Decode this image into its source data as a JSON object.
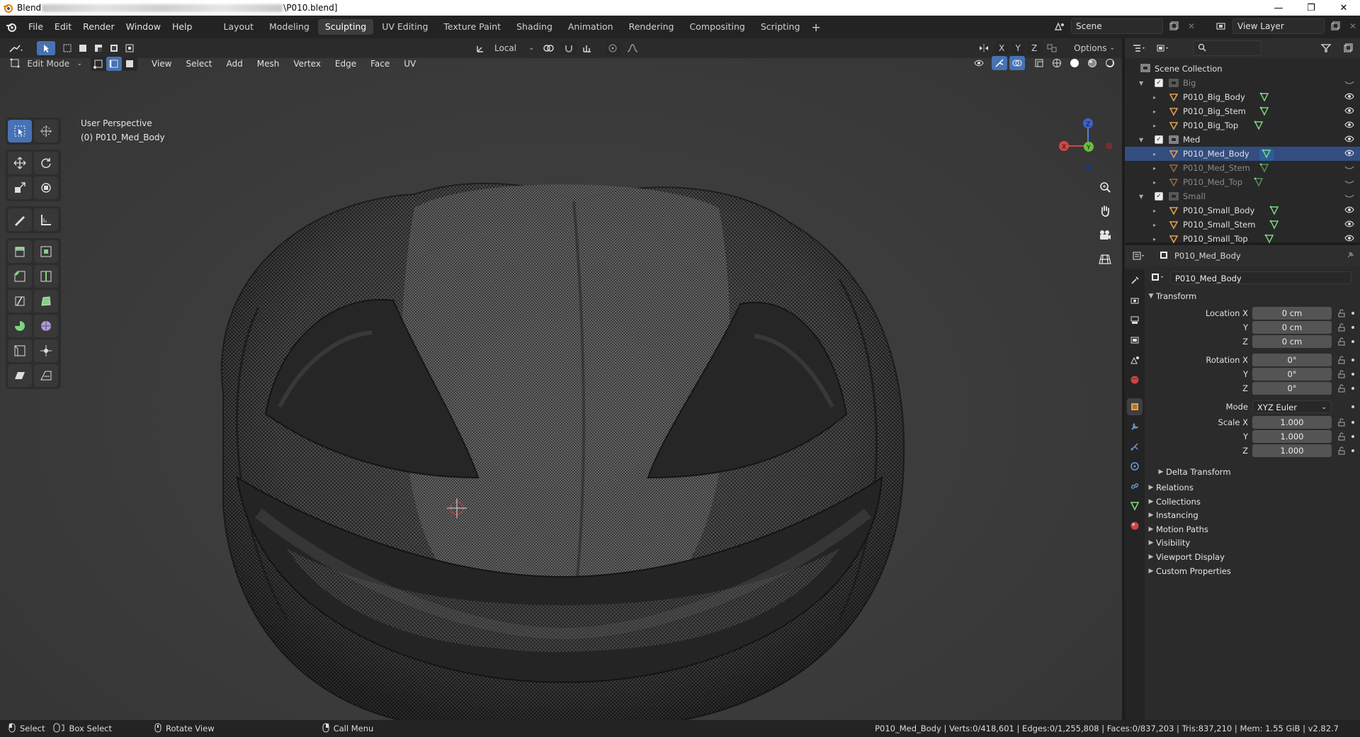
{
  "titlebar": {
    "app_prefix": "Blend",
    "file_suffix": "\\P010.blend]",
    "minimize": "—",
    "maximize": "❐",
    "close": "✕"
  },
  "menu": {
    "file": "File",
    "edit": "Edit",
    "render": "Render",
    "window": "Window",
    "help": "Help"
  },
  "workspaces": [
    "Layout",
    "Modeling",
    "Sculpting",
    "UV Editing",
    "Texture Paint",
    "Shading",
    "Animation",
    "Rendering",
    "Compositing",
    "Scripting"
  ],
  "active_workspace": "Sculpting",
  "scene": {
    "label": "Scene",
    "view_layer": "View Layer"
  },
  "viewport_header": {
    "transform_orientation": "Local",
    "mode": "Edit Mode",
    "menus": [
      "View",
      "Select",
      "Add",
      "Mesh",
      "Vertex",
      "Edge",
      "Face",
      "UV"
    ],
    "axes": [
      "X",
      "Y",
      "Z"
    ],
    "options": "Options"
  },
  "viewport_info": {
    "perspective": "User Perspective",
    "object": "(0) P010_Med_Body"
  },
  "gizmo": {
    "x": "X",
    "y": "Y",
    "z": "Z"
  },
  "outliner": {
    "root": "Scene Collection",
    "items": [
      {
        "name": "Big",
        "kind": "collection",
        "dim": true
      },
      {
        "name": "P010_Big_Body",
        "kind": "mesh"
      },
      {
        "name": "P010_Big_Stem",
        "kind": "mesh"
      },
      {
        "name": "P010_Big_Top",
        "kind": "mesh"
      },
      {
        "name": "Med",
        "kind": "collection"
      },
      {
        "name": "P010_Med_Body",
        "kind": "mesh",
        "selected": true
      },
      {
        "name": "P010_Med_Stem",
        "kind": "mesh",
        "dim": true
      },
      {
        "name": "P010_Med_Top",
        "kind": "mesh",
        "dim": true
      },
      {
        "name": "Small",
        "kind": "collection",
        "dim": true
      },
      {
        "name": "P010_Small_Body",
        "kind": "mesh"
      },
      {
        "name": "P010_Small_Stem",
        "kind": "mesh"
      },
      {
        "name": "P010_Small_Top",
        "kind": "mesh"
      }
    ]
  },
  "properties": {
    "object_name": "P010_Med_Body",
    "data_name": "P010_Med_Body",
    "transform_label": "Transform",
    "location_x_label": "Location X",
    "location_x": "0 cm",
    "location_y_label": "Y",
    "location_y": "0 cm",
    "location_z_label": "Z",
    "location_z": "0 cm",
    "rotation_x_label": "Rotation X",
    "rotation_x": "0°",
    "rotation_y_label": "Y",
    "rotation_y": "0°",
    "rotation_z_label": "Z",
    "rotation_z": "0°",
    "mode_label": "Mode",
    "mode_value": "XYZ Euler",
    "scale_x_label": "Scale X",
    "scale_x": "1.000",
    "scale_y_label": "Y",
    "scale_y": "1.000",
    "scale_z_label": "Z",
    "scale_z": "1.000",
    "delta_transform": "Delta Transform",
    "sections": [
      "Relations",
      "Collections",
      "Instancing",
      "Motion Paths",
      "Visibility",
      "Viewport Display",
      "Custom Properties"
    ]
  },
  "statusbar": {
    "select": "Select",
    "box_select": "Box Select",
    "rotate_view": "Rotate View",
    "call_menu": "Call Menu",
    "stats": "P010_Med_Body | Verts:0/418,601 | Edges:0/1,255,808 | Faces:0/837,203 | Tris:837,210 | Mem: 1.55 GiB | v2.82.7"
  },
  "colors": {
    "accent": "#4772b3",
    "selection_row": "#334d80",
    "mesh_icon": "#e0a050",
    "data_icon": "#7fd37f"
  }
}
